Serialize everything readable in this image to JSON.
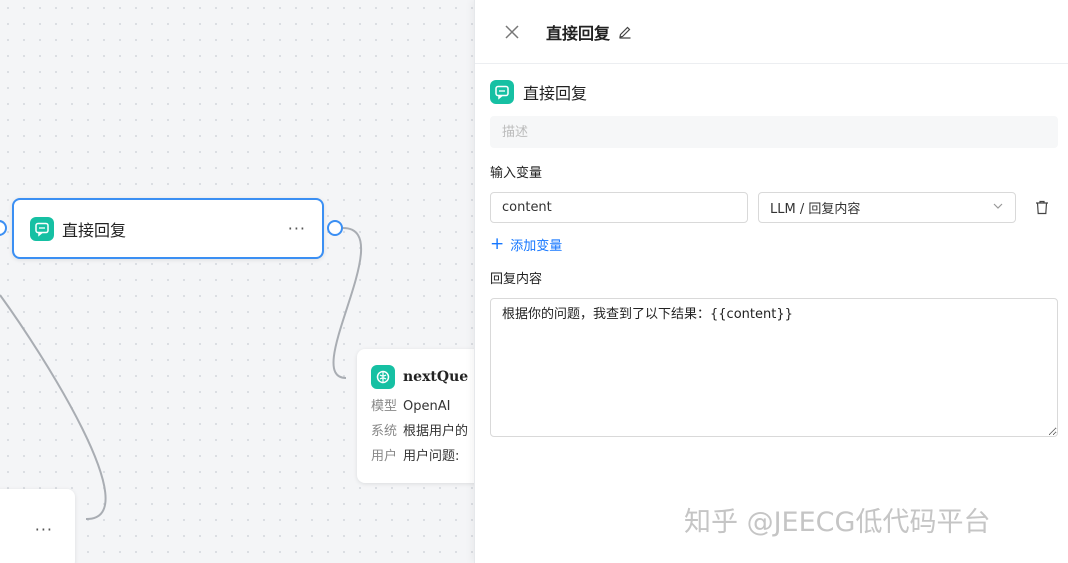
{
  "canvas": {
    "reply_node": {
      "title": "直接回复",
      "more": "···"
    },
    "llm_node": {
      "title": "nextQue",
      "rows": [
        {
          "key": "模型",
          "value": "OpenAI"
        },
        {
          "key": "系统",
          "value": "根据用户的"
        },
        {
          "key": "用户",
          "value": "用户问题:"
        }
      ]
    },
    "bottom_node": {
      "more": "···"
    }
  },
  "panel": {
    "header_title": "直接回复",
    "node_name": "直接回复",
    "description_placeholder": "描述",
    "input_vars_label": "输入变量",
    "variable": {
      "name": "content",
      "source": "LLM / 回复内容"
    },
    "add_var_label": "添加变量",
    "reply_label": "回复内容",
    "reply_content": "根据你的问题，我查到了以下结果：{{content}}"
  },
  "watermark": "知乎 @JEECG低代码平台",
  "colors": {
    "accent": "#3b8ff3",
    "icon_bg": "#16c0a3",
    "link": "#1677ff"
  }
}
